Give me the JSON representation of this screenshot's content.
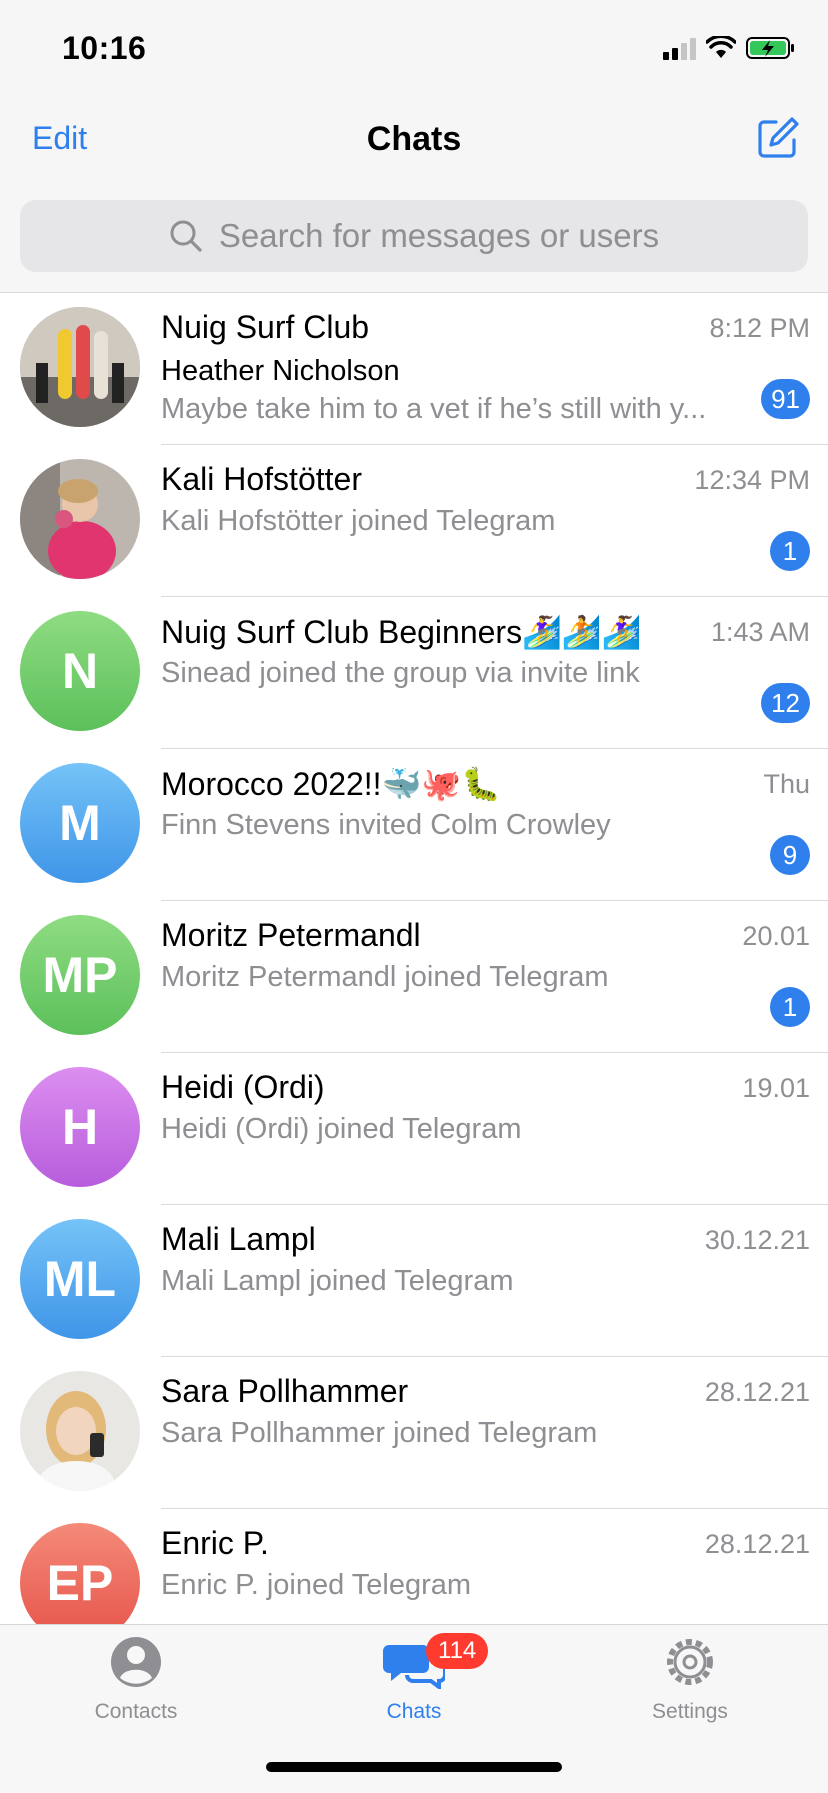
{
  "status_bar": {
    "time": "10:16"
  },
  "header": {
    "edit_label": "Edit",
    "title": "Chats"
  },
  "search": {
    "placeholder": "Search for messages or users"
  },
  "chats": [
    {
      "name": "Nuig Surf Club",
      "time": "8:12 PM",
      "sender": "Heather Nicholson",
      "preview": "Maybe take him to a vet if he’s still with y...",
      "badge": "91"
    },
    {
      "name": "Kali Hofstötter",
      "time": "12:34 PM",
      "preview": "Kali Hofstötter joined Telegram",
      "badge": "1"
    },
    {
      "name": "Nuig Surf Club Beginners🏄‍♀️🏄🏄‍♀️",
      "time": "1:43 AM",
      "preview": "Sinead joined the group via invite link",
      "badge": "12",
      "initials": "N"
    },
    {
      "name": "Morocco 2022!!🐳🐙🐛",
      "time": "Thu",
      "preview": "Finn Stevens invited Colm Crowley",
      "badge": "9",
      "initials": "M"
    },
    {
      "name": "Moritz Petermandl",
      "time": "20.01",
      "preview": "Moritz Petermandl joined Telegram",
      "badge": "1",
      "initials": "MP"
    },
    {
      "name": "Heidi (Ordi)",
      "time": "19.01",
      "preview": "Heidi (Ordi) joined Telegram",
      "initials": "H"
    },
    {
      "name": "Mali Lampl",
      "time": "30.12.21",
      "preview": "Mali Lampl joined Telegram",
      "initials": "ML"
    },
    {
      "name": "Sara Pollhammer",
      "time": "28.12.21",
      "preview": "Sara Pollhammer joined Telegram"
    },
    {
      "name": "Enric P.",
      "time": "28.12.21",
      "preview": "Enric P. joined Telegram",
      "initials": "EP"
    }
  ],
  "tabbar": {
    "contacts_label": "Contacts",
    "chats_label": "Chats",
    "chats_badge": "114",
    "settings_label": "Settings"
  },
  "colors": {
    "accent": "#2f80ed",
    "badge_red": "#ff3b30",
    "avatar_green": "#6fcf6f",
    "avatar_blue": "#4aa3ec",
    "avatar_purple": "#c367e0",
    "avatar_red": "#ef6a5a"
  }
}
